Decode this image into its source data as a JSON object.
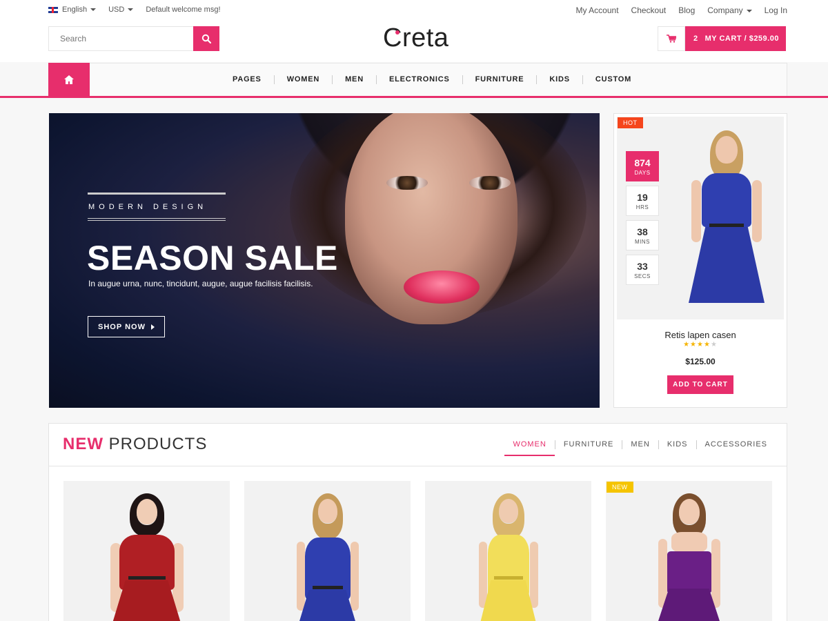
{
  "topbar": {
    "language": "English",
    "currency": "USD",
    "welcome": "Default welcome msg!",
    "links": [
      "My Account",
      "Checkout",
      "Blog",
      "Company",
      "Log In"
    ]
  },
  "header": {
    "search_placeholder": "Search",
    "logo": "Creta",
    "cart_count": "2",
    "cart_label": "MY CART / $259.00"
  },
  "nav": {
    "items": [
      "PAGES",
      "WOMEN",
      "MEN",
      "ELECTRONICS",
      "FURNITURE",
      "KIDS",
      "CUSTOM"
    ]
  },
  "hero": {
    "subtitle": "MODERN DESIGN",
    "title": "SEASON SALE",
    "description": "In augue urna, nunc, tincidunt, augue, augue facilisis facilisis.",
    "button": "SHOP NOW"
  },
  "deal": {
    "badge": "HOT",
    "countdown": [
      {
        "value": "874",
        "unit": "DAYS"
      },
      {
        "value": "19",
        "unit": "HRS"
      },
      {
        "value": "38",
        "unit": "MINS"
      },
      {
        "value": "33",
        "unit": "SECS"
      }
    ],
    "product_name": "Retis lapen casen",
    "rating": 4,
    "rating_max": 5,
    "price": "$125.00",
    "button": "ADD TO CART"
  },
  "new_products": {
    "title_highlight": "NEW",
    "title_rest": "PRODUCTS",
    "tabs": [
      "WOMEN",
      "FURNITURE",
      "MEN",
      "KIDS",
      "ACCESSORIES"
    ],
    "active_tab": "WOMEN",
    "badge": "NEW"
  },
  "colors": {
    "accent": "#e72e6c",
    "hot": "#f5451c",
    "new": "#f5c400",
    "star": "#f5b400"
  }
}
